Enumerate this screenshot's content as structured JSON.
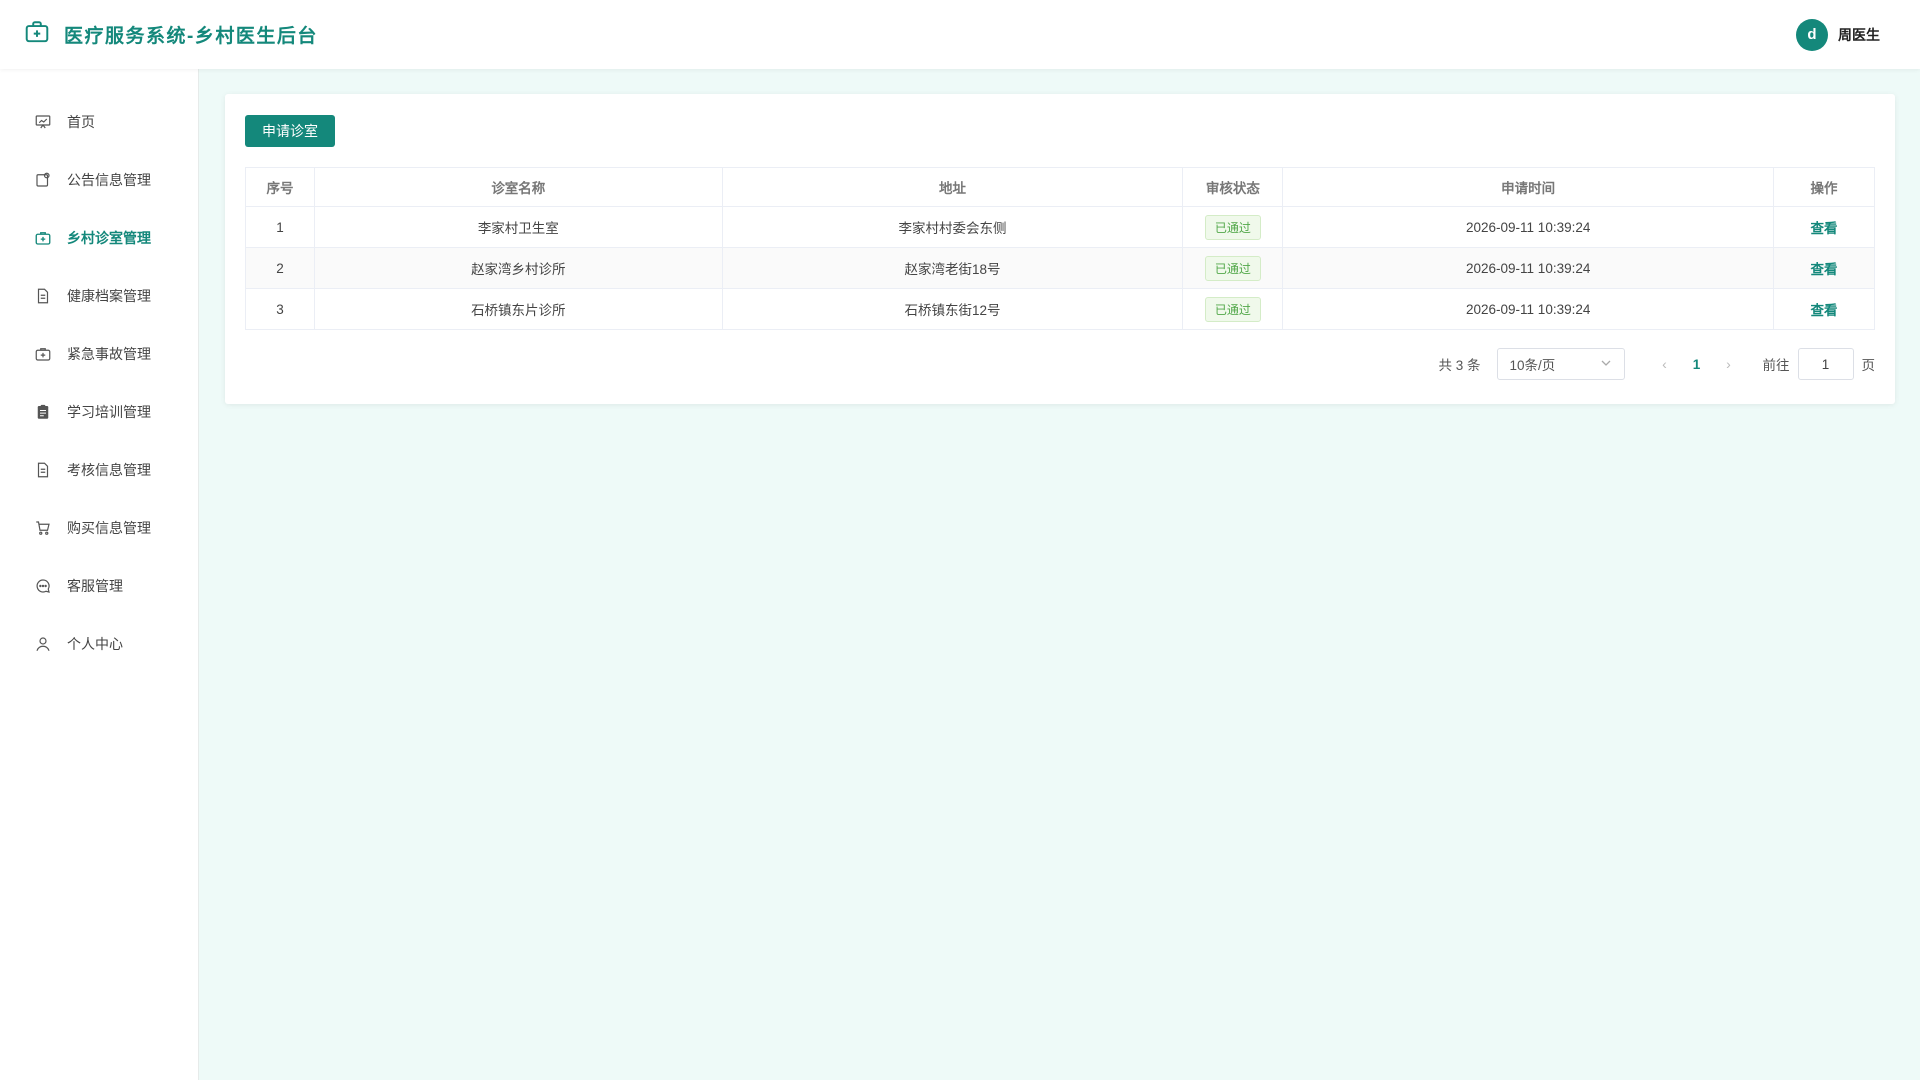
{
  "header": {
    "title": "医疗服务系统-乡村医生后台",
    "user_avatar": "d",
    "user_name": "周医生",
    "accent": "#14887b"
  },
  "sidebar": {
    "items": [
      {
        "label": "首页",
        "icon": "chart-board-icon",
        "active": false
      },
      {
        "label": "公告信息管理",
        "icon": "notice-icon",
        "active": false
      },
      {
        "label": "乡村诊室管理",
        "icon": "medical-kit-icon",
        "active": true
      },
      {
        "label": "健康档案管理",
        "icon": "document-icon",
        "active": false
      },
      {
        "label": "紧急事故管理",
        "icon": "medical-kit-icon",
        "active": false
      },
      {
        "label": "学习培训管理",
        "icon": "clipboard-icon",
        "active": false
      },
      {
        "label": "考核信息管理",
        "icon": "document-icon",
        "active": false
      },
      {
        "label": "购买信息管理",
        "icon": "cart-icon",
        "active": false
      },
      {
        "label": "客服管理",
        "icon": "chat-icon",
        "active": false
      },
      {
        "label": "个人中心",
        "icon": "user-icon",
        "active": false
      }
    ]
  },
  "main": {
    "apply_button": "申请诊室",
    "table": {
      "headers": [
        "序号",
        "诊室名称",
        "地址",
        "审核状态",
        "申请时间",
        "操作"
      ],
      "rows": [
        {
          "index": "1",
          "name": "李家村卫生室",
          "address": "李家村村委会东侧",
          "status": "已通过",
          "time": "2026-09-11 10:39:24",
          "action": "查看"
        },
        {
          "index": "2",
          "name": "赵家湾乡村诊所",
          "address": "赵家湾老街18号",
          "status": "已通过",
          "time": "2026-09-11 10:39:24",
          "action": "查看"
        },
        {
          "index": "3",
          "name": "石桥镇东片诊所",
          "address": "石桥镇东街12号",
          "status": "已通过",
          "time": "2026-09-11 10:39:24",
          "action": "查看"
        }
      ]
    },
    "pagination": {
      "total": "共 3 条",
      "page_size": "10条/页",
      "current_page": "1",
      "goto_label": "前往",
      "goto_value": "1",
      "page_suffix": "页"
    }
  }
}
